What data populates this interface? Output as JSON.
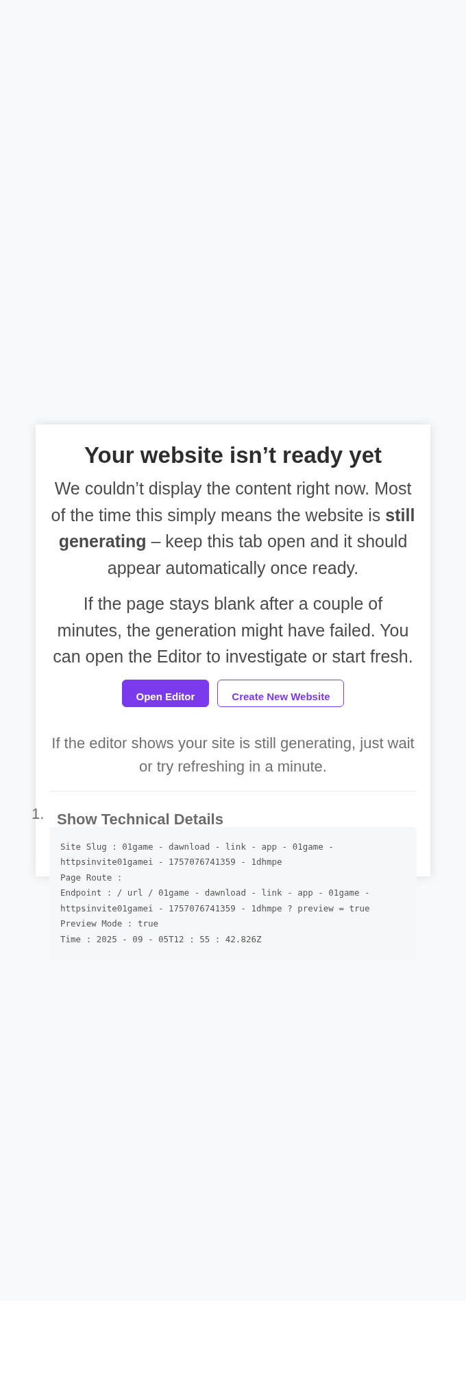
{
  "card": {
    "title": "Your website isn’t ready yet",
    "paragraphs": [
      "We couldn’t display the content right now. Most of the time this simply means the website is **still generating** – keep this tab open and it should appear automatically once ready.",
      "If the page stays blank after a couple of minutes, the generation might have failed. You can open the Editor to investigate or start fresh."
    ],
    "buttons": [
      {
        "label": "Open Editor",
        "kind": "primary"
      },
      {
        "label": "Create New Website",
        "kind": "outline"
      }
    ],
    "note": "If the editor shows your site is still generating, just wait or try refreshing in a minute.",
    "details": {
      "number": "1.",
      "summary": "Show Technical Details",
      "lines": [
        "Site Slug : 01game - dawnload - link - app - 01game - httpsinvite01gamei - 1757076741359 - 1dhmpe",
        "Page Route :",
        "Endpoint : / url / 01game - dawnload - link - app - 01game - httpsinvite01gamei - 1757076741359 - 1dhmpe ? preview = true",
        "Preview Mode : true",
        "Time : 2025 - 09 - 05T12 : 55 : 42.826Z"
      ]
    }
  }
}
